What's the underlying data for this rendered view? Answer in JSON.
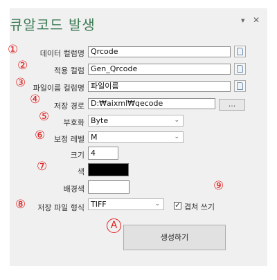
{
  "header": {
    "title": "큐알코드 발생",
    "dropdown_glyph": "▾",
    "close_glyph": "✕"
  },
  "markers": {
    "m1": "①",
    "m2": "②",
    "m3": "③",
    "m4": "④",
    "m5": "⑤",
    "m6": "⑥",
    "m7": "⑦",
    "m8": "⑧",
    "m9": "⑨",
    "mA": "A"
  },
  "fields": {
    "data_column": {
      "label": "데이터 컬럼명",
      "value": "Qrcode"
    },
    "apply_column": {
      "label": "적용 컬럼",
      "value": "Gen_Qrcode"
    },
    "filename_column": {
      "label": "파일이름 컬럼명",
      "value": "파일이름"
    },
    "save_path": {
      "label": "저장 경로",
      "value": "D:₩aixml₩qecode",
      "browse": "..."
    },
    "encoding": {
      "label": "부호화",
      "value": "Byte"
    },
    "correction": {
      "label": "보정 레벨",
      "value": "M"
    },
    "size": {
      "label": "크기",
      "value": "4"
    },
    "color": {
      "label": "색",
      "value": "#000000"
    },
    "bgcolor": {
      "label": "배경색",
      "value": "#ffffff"
    },
    "file_format": {
      "label": "저장 파일 형식",
      "value": "TIFF"
    },
    "overwrite": {
      "label": "겹쳐 쓰기",
      "checked": true
    }
  },
  "generate_button": "생성하기",
  "icons": {
    "column_picker": "page-icon",
    "dropdown": "chevron-down-icon",
    "close": "close-icon"
  }
}
